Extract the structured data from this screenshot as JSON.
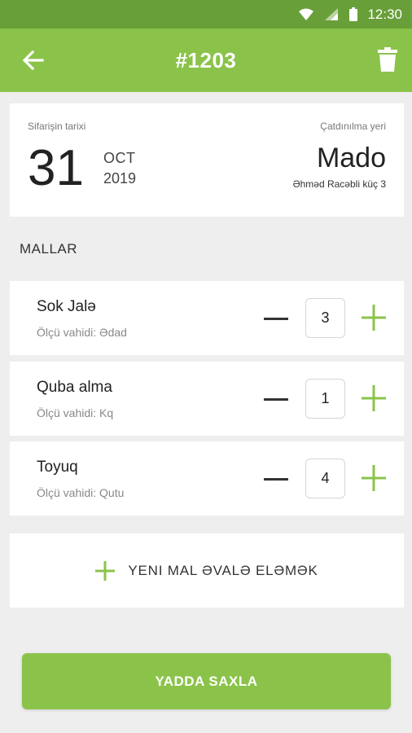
{
  "status_bar": {
    "time": "12:30",
    "icons": [
      "wifi-icon",
      "signal-icon",
      "battery-icon"
    ]
  },
  "app_bar": {
    "title": "#1203",
    "back_icon": "arrow-left-icon",
    "delete_icon": "trash-icon"
  },
  "order": {
    "date_label": "Sifarişin tarixi",
    "day": "31",
    "month": "OCT",
    "year": "2019",
    "delivery_label": "Çatdınılma yeri",
    "place": "Mado",
    "address": "Əhməd Racəbli küç 3"
  },
  "products_section": {
    "title": "MALLAR"
  },
  "products": [
    {
      "name": "Sok Jalə",
      "unit": "Ölçü vahidi: Ədad",
      "qty": "3"
    },
    {
      "name": "Quba alma",
      "unit": "Ölçü vahidi: Kq",
      "qty": "1"
    },
    {
      "name": "Toyuq",
      "unit": "Ölçü vahidi: Qutu",
      "qty": "4"
    }
  ],
  "add_product": {
    "label": "YENI MAL ƏVALƏ ELƏMƏK"
  },
  "save_button": {
    "label": "YADDA SAXLA"
  },
  "colors": {
    "primary": "#8bc34a",
    "status_bar": "#689f38",
    "background": "#eeeeee"
  }
}
